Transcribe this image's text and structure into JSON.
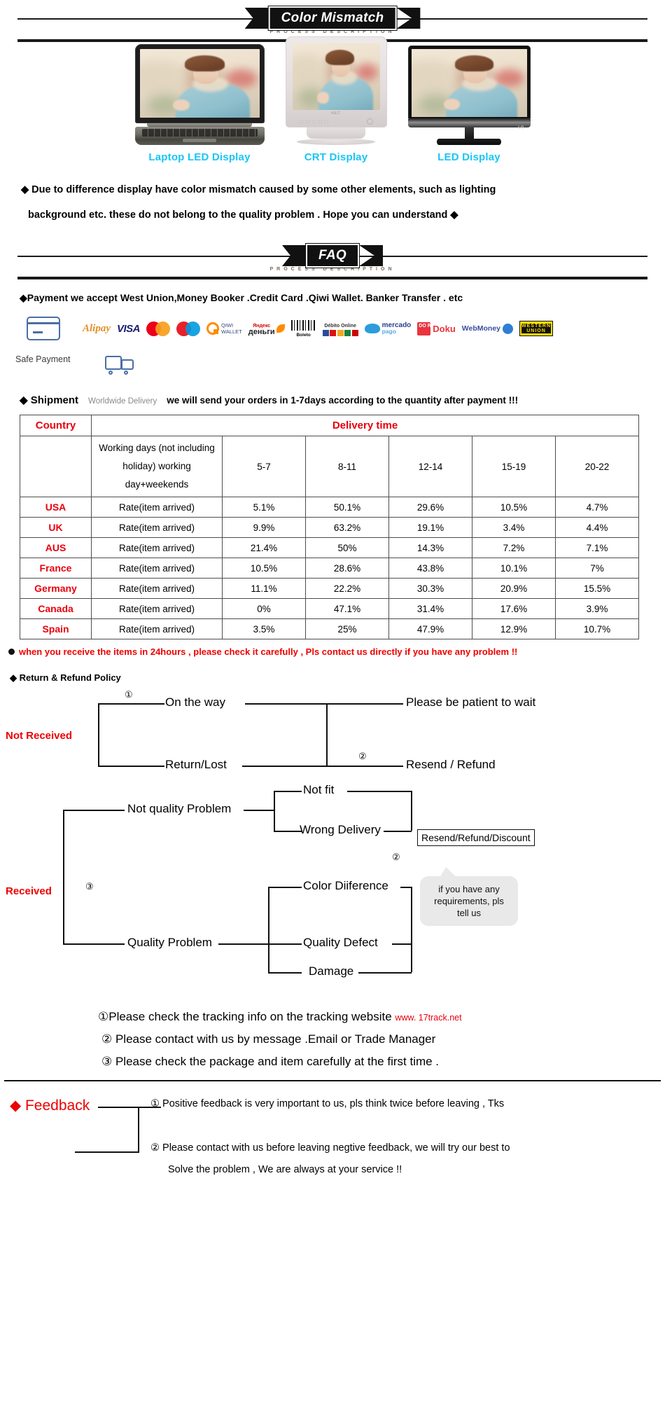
{
  "banner_color_mismatch": {
    "title": "Color Mismatch",
    "subtitle": "PROCESS DESCRIPTION"
  },
  "banner_faq": {
    "title": "FAQ",
    "subtitle": "PROCESS DESCRIPTION"
  },
  "displays": {
    "items": [
      {
        "label": "Laptop LED Display",
        "brand": ""
      },
      {
        "label": "CRT Display",
        "brand": "NEC"
      },
      {
        "label": "LED  Display",
        "brand": "LG"
      }
    ],
    "label_color": "#19c6f5"
  },
  "color_note": {
    "line1": "◆ Due to difference display have color mismatch caused by some other elements, such as lighting",
    "line2": "background etc.  these do not belong to the quality problem . Hope you can understand ◆"
  },
  "payment": {
    "headline": "◆Payment we accept West Union,Money Booker .Credit Card .Qiwi Wallet. Banker Transfer . etc",
    "safe_payment_label": "Safe Payment",
    "logos": [
      "Alipay",
      "VISA",
      "MasterCard",
      "Maestro",
      "QIWI WALLET",
      "Яндекс деньги",
      "Boleto",
      "Débito Online",
      "mercado pago",
      "Doku",
      "WebMoney",
      "WESTERN UNION"
    ],
    "qiwi_line1": "QIWI",
    "qiwi_line2": "WALLET",
    "yandex_top": "Яндекс",
    "yandex_bottom": "деньги",
    "boleto_label": "Boleto",
    "debito_label": "Débito Online",
    "mercado_top": "mercado",
    "mercado_bottom": "pago",
    "doku_mark": "DO RU",
    "doku_label": "Doku",
    "webmoney_label": "WebMoney",
    "wu_line1": "WESTERN",
    "wu_line2": "UNION"
  },
  "shipment": {
    "title": "◆ Shipment",
    "worldwide": "Worldwide Delivery",
    "text": "we will send your orders in 1-7days according to the quantity after payment  !!!"
  },
  "table": {
    "col_country": "Country",
    "col_delivery_time": "Delivery time",
    "working_days": "Working days (not including holiday) working day+weekends",
    "day_ranges": [
      "5-7",
      "8-11",
      "12-14",
      "15-19",
      "20-22"
    ],
    "rate_label": "Rate(item arrived)",
    "rows": [
      {
        "country": "USA",
        "rates": [
          "5.1%",
          "50.1%",
          "29.6%",
          "10.5%",
          "4.7%"
        ]
      },
      {
        "country": "UK",
        "rates": [
          "9.9%",
          "63.2%",
          "19.1%",
          "3.4%",
          "4.4%"
        ]
      },
      {
        "country": "AUS",
        "rates": [
          "21.4%",
          "50%",
          "14.3%",
          "7.2%",
          "7.1%"
        ]
      },
      {
        "country": "France",
        "rates": [
          "10.5%",
          "28.6%",
          "43.8%",
          "10.1%",
          "7%"
        ]
      },
      {
        "country": "Germany",
        "rates": [
          "11.1%",
          "22.2%",
          "30.3%",
          "20.9%",
          "15.5%"
        ]
      },
      {
        "country": "Canada",
        "rates": [
          "0%",
          "47.1%",
          "31.4%",
          "17.6%",
          "3.9%"
        ]
      },
      {
        "country": "Spain",
        "rates": [
          "3.5%",
          "25%",
          "47.9%",
          "12.9%",
          "10.7%"
        ]
      }
    ],
    "header_color": "#e8000d"
  },
  "warning": "when you receive the items in 24hours , please check it carefully , Pls contact us directly if you have any problem !!",
  "return_policy": {
    "title": "◆  Return & Refund Policy",
    "not_received_label": "Not Received",
    "received_label": "Received",
    "on_the_way": "On the way",
    "return_lost": "Return/Lost",
    "please_wait": "Please be patient to wait",
    "resend_refund": "Resend / Refund",
    "not_quality_problem": "Not quality Problem",
    "quality_problem": "Quality Problem",
    "not_fit": "Not fit",
    "wrong_delivery": "Wrong Delivery",
    "color_difference": "Color Diiference",
    "quality_defect": "Quality Defect",
    "damage": "Damage",
    "resend_refund_discount": "Resend/Refund/Discount",
    "bubble": "if you have any requirements, pls tell us",
    "mark1": "①",
    "mark2": "②",
    "mark3": "③"
  },
  "steps": {
    "s1_text": "①Please check the tracking info on the tracking website",
    "s1_url": "www. 17track.net",
    "s2": "② Please contact with us by message .Email or Trade Manager",
    "s3": "③ Please check the package and item carefully at the first time ."
  },
  "feedback": {
    "title": "◆ Feedback",
    "line1": "① Positive feedback is very important to us, pls think twice before leaving , Tks",
    "line2": "② Please contact with us before leaving negtive feedback, we will try our best to",
    "line3": "Solve the problem , We are always at your service !!",
    "color": "#ee0000"
  }
}
